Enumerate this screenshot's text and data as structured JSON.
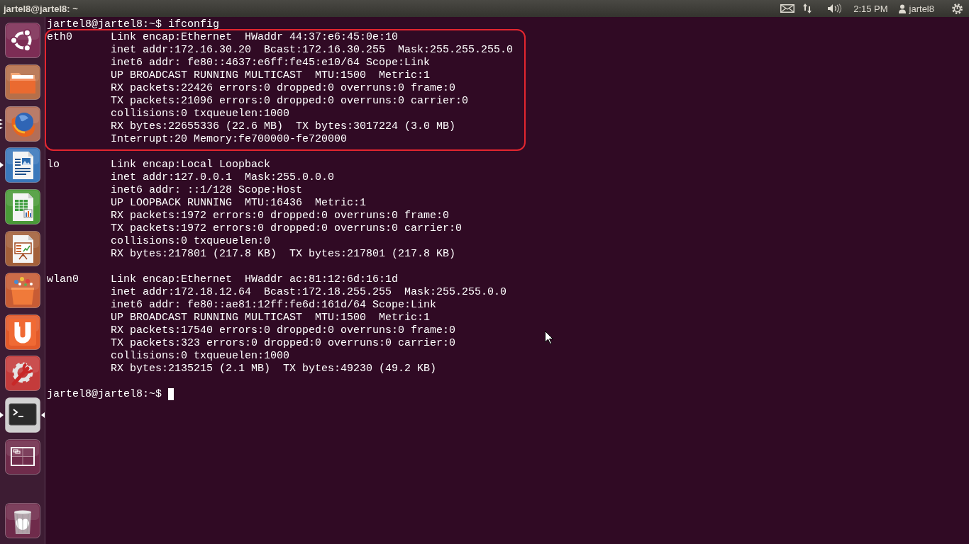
{
  "top_bar": {
    "title": "jartel8@jartel8: ~",
    "clock": "2:15 PM",
    "user": "jartel8"
  },
  "launcher": {
    "items": [
      {
        "kind": "home",
        "running": false,
        "multiple_windows": false,
        "focused": false
      },
      {
        "kind": "files",
        "running": false,
        "multiple_windows": false,
        "focused": false
      },
      {
        "kind": "browser",
        "running": true,
        "multiple_windows": true,
        "focused": false
      },
      {
        "kind": "writer",
        "running": true,
        "multiple_windows": false,
        "focused": false
      },
      {
        "kind": "calc",
        "running": false,
        "multiple_windows": false,
        "focused": false
      },
      {
        "kind": "impress",
        "running": false,
        "multiple_windows": false,
        "focused": false
      },
      {
        "kind": "store",
        "running": false,
        "multiple_windows": false,
        "focused": false
      },
      {
        "kind": "cloud",
        "running": false,
        "multiple_windows": false,
        "focused": false
      },
      {
        "kind": "settings",
        "running": false,
        "multiple_windows": false,
        "focused": false
      },
      {
        "kind": "terminal",
        "running": true,
        "multiple_windows": false,
        "focused": true
      },
      {
        "kind": "workspaces",
        "running": false,
        "multiple_windows": false,
        "focused": false
      },
      {
        "kind": "trash",
        "running": false,
        "multiple_windows": false,
        "focused": false
      }
    ]
  },
  "terminal": {
    "command_line": "jartel8@jartel8:~$ ifconfig",
    "interfaces": [
      {
        "name": "eth0",
        "highlighted": true,
        "lines": [
          "Link encap:Ethernet  HWaddr 44:37:e6:45:0e:10",
          "inet addr:172.16.30.20  Bcast:172.16.30.255  Mask:255.255.255.0",
          "inet6 addr: fe80::4637:e6ff:fe45:e10/64 Scope:Link",
          "UP BROADCAST RUNNING MULTICAST  MTU:1500  Metric:1",
          "RX packets:22426 errors:0 dropped:0 overruns:0 frame:0",
          "TX packets:21096 errors:0 dropped:0 overruns:0 carrier:0",
          "collisions:0 txqueuelen:1000",
          "RX bytes:22655336 (22.6 MB)  TX bytes:3017224 (3.0 MB)",
          "Interrupt:20 Memory:fe700000-fe720000"
        ]
      },
      {
        "name": "lo",
        "highlighted": false,
        "lines": [
          "Link encap:Local Loopback",
          "inet addr:127.0.0.1  Mask:255.0.0.0",
          "inet6 addr: ::1/128 Scope:Host",
          "UP LOOPBACK RUNNING  MTU:16436  Metric:1",
          "RX packets:1972 errors:0 dropped:0 overruns:0 frame:0",
          "TX packets:1972 errors:0 dropped:0 overruns:0 carrier:0",
          "collisions:0 txqueuelen:0",
          "RX bytes:217801 (217.8 KB)  TX bytes:217801 (217.8 KB)"
        ]
      },
      {
        "name": "wlan0",
        "highlighted": false,
        "lines": [
          "Link encap:Ethernet  HWaddr ac:81:12:6d:16:1d",
          "inet addr:172.18.12.64  Bcast:172.18.255.255  Mask:255.255.0.0",
          "inet6 addr: fe80::ae81:12ff:fe6d:161d/64 Scope:Link",
          "UP BROADCAST RUNNING MULTICAST  MTU:1500  Metric:1",
          "RX packets:17540 errors:0 dropped:0 overruns:0 frame:0",
          "TX packets:323 errors:0 dropped:0 overruns:0 carrier:0",
          "collisions:0 txqueuelen:1000",
          "RX bytes:2135215 (2.1 MB)  TX bytes:49230 (49.2 KB)"
        ]
      }
    ],
    "prompt": "jartel8@jartel8:~$"
  }
}
